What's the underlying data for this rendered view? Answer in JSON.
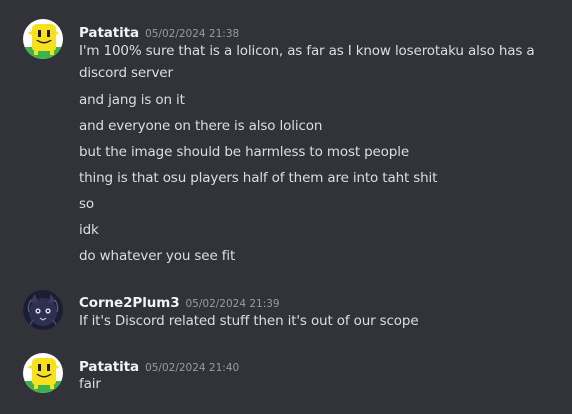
{
  "messages": [
    {
      "author": "Patatita",
      "timestamp": "05/02/2024 21:38",
      "avatar_icon": "yellow-smiley-avatar",
      "lines": [
        "I'm 100% sure that is a lolicon, as far as I know loserotaku also has a discord server",
        "and jang is on it",
        "and everyone on there is also lolicon",
        "but the image should be harmless to most people",
        "thing is that osu players half of them are into taht shit",
        "so",
        "idk",
        "do whatever you see fit"
      ]
    },
    {
      "author": "Corne2Plum3",
      "timestamp": "05/02/2024 21:39",
      "avatar_icon": "dark-creature-avatar",
      "lines": [
        "If it's Discord related stuff then it's out of our scope"
      ]
    },
    {
      "author": "Patatita",
      "timestamp": "05/02/2024 21:40",
      "avatar_icon": "yellow-smiley-avatar",
      "lines": [
        "fair"
      ]
    }
  ],
  "colors": {
    "background": "#313338",
    "username": "#f2f3f5",
    "text": "#dbdee1",
    "timestamp": "#949ba4"
  }
}
